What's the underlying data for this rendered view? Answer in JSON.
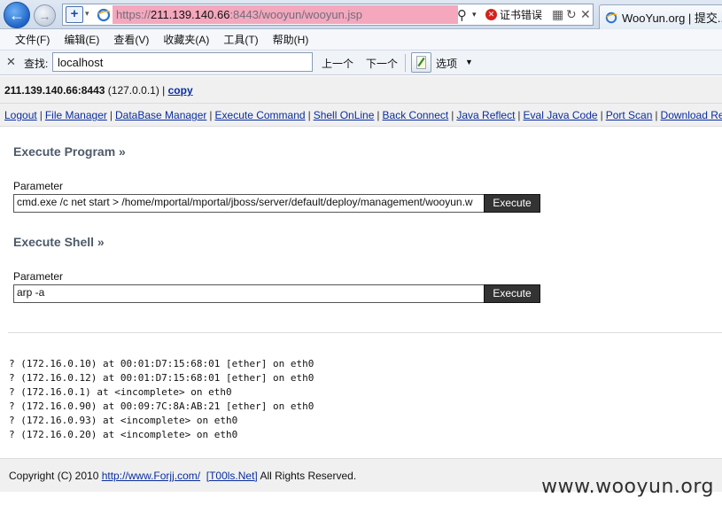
{
  "browser": {
    "address": {
      "protocol": "https://",
      "host": "211.139.140.66",
      "path": ":8443/wooyun/wooyun.jsp"
    },
    "cert_error": "证书错误",
    "tab_title": "WooYun.org | 提交..."
  },
  "menubar": {
    "items": [
      "文件(F)",
      "编辑(E)",
      "查看(V)",
      "收藏夹(A)",
      "工具(T)",
      "帮助(H)"
    ]
  },
  "findbar": {
    "label": "查找:",
    "value": "localhost",
    "prev": "上一个",
    "next": "下一个",
    "options": "选项"
  },
  "host_info": {
    "host": "211.139.140.66:8443",
    "ip": " (127.0.0.1) | ",
    "copy": "copy"
  },
  "nav_links": [
    "Logout",
    "File Manager",
    "DataBase Manager",
    "Execute Command",
    "Shell OnLine",
    "Back Connect",
    "Java Reflect",
    "Eval Java Code",
    "Port Scan",
    "Download Remote File"
  ],
  "execute_program": {
    "title": "Execute Program »",
    "param_label": "Parameter",
    "value": "cmd.exe /c net start > /home/mportal/mportal/jboss/server/default/deploy/management/wooyun.w",
    "button": "Execute"
  },
  "execute_shell": {
    "title": "Execute Shell »",
    "param_label": "Parameter",
    "value": "arp -a",
    "button": "Execute"
  },
  "output": [
    "? (172.16.0.10) at 00:01:D7:15:68:01 [ether] on eth0",
    "? (172.16.0.12) at 00:01:D7:15:68:01 [ether] on eth0",
    "? (172.16.0.1) at <incomplete> on eth0",
    "? (172.16.0.90) at 00:09:7C:8A:AB:21 [ether] on eth0",
    "? (172.16.0.93) at <incomplete> on eth0",
    "? (172.16.0.20) at <incomplete> on eth0"
  ],
  "footer": {
    "prefix": "Copyright (C) 2010 ",
    "link1": "http://www.Forjj.com/",
    "link2": "[T00ls.Net]",
    "suffix": " All Rights Reserved."
  },
  "watermark": "www.wooyun.org",
  "colors": {
    "link": "#0a2d9e",
    "section_title": "#4d5a68",
    "button_bg": "#333333",
    "url_highlight": "#f4a7bd",
    "cert_error_icon": "#d3231d"
  }
}
